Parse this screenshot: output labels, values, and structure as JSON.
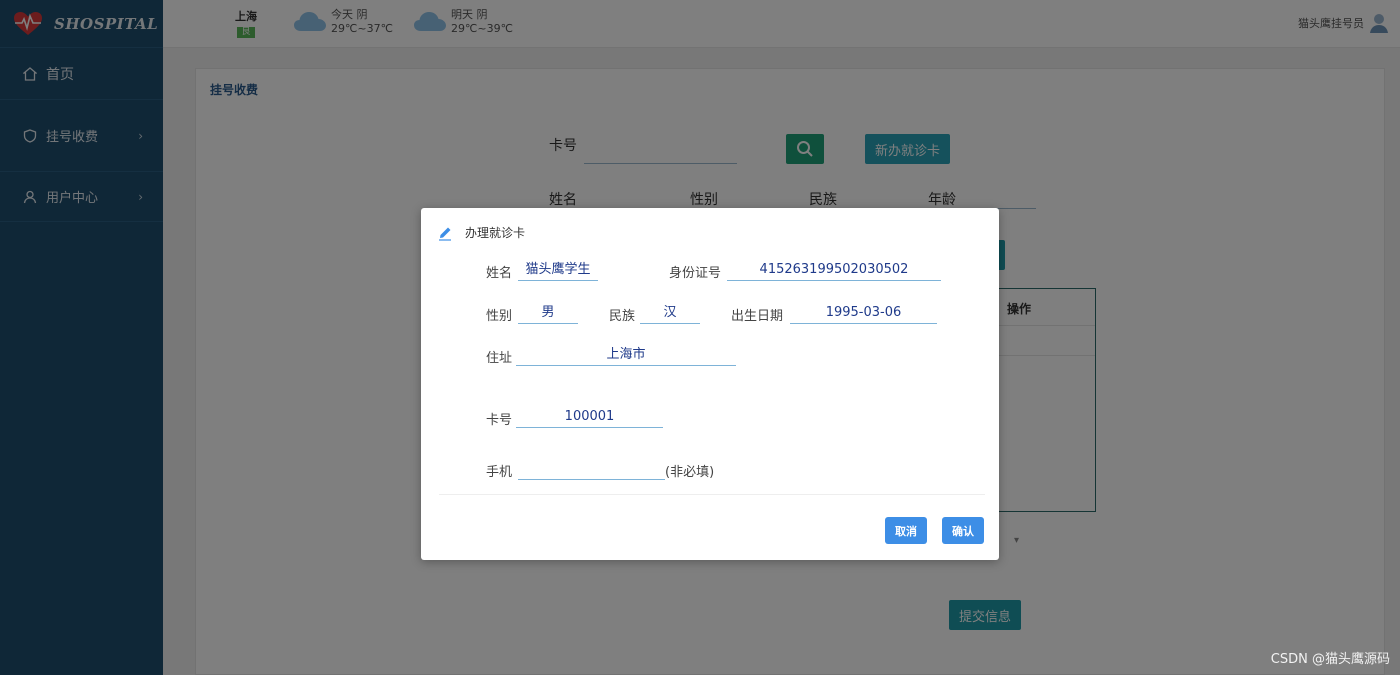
{
  "brand": {
    "name": "SHOSPITAL"
  },
  "sidebar": {
    "items": [
      {
        "label": "首页",
        "icon": "home-icon"
      },
      {
        "label": "挂号收费",
        "icon": "shield-icon",
        "has_children": true
      },
      {
        "label": "用户中心",
        "icon": "user-icon",
        "has_children": true
      }
    ]
  },
  "header": {
    "city": "上海",
    "aqi": "良",
    "today": {
      "label": "今天",
      "condition": "阴",
      "temp": "29℃~37℃"
    },
    "tomorrow": {
      "label": "明天",
      "condition": "阴",
      "temp": "29℃~39℃"
    },
    "user": "猫头鹰挂号员"
  },
  "page": {
    "title": "挂号收费",
    "card_label": "卡号",
    "new_card_button": "新办就诊卡",
    "name_label": "姓名",
    "gender_label": "性别",
    "ethnicity_label": "民族",
    "age_label": "年龄",
    "table_col_action": "操作",
    "submit_button": "提交信息"
  },
  "modal": {
    "title": "办理就诊卡",
    "name_label": "姓名",
    "name_value": "猫头鹰学生",
    "id_label": "身份证号",
    "id_value": "415263199502030502",
    "gender_label": "性别",
    "gender_value": "男",
    "ethnicity_label": "民族",
    "ethnicity_value": "汉",
    "birth_label": "出生日期",
    "birth_value": "1995-03-06",
    "address_label": "住址",
    "address_value": "上海市",
    "card_label": "卡号",
    "card_value": "100001",
    "phone_label": "手机",
    "phone_value": "",
    "phone_note": "(非必填)",
    "cancel_button": "取消",
    "confirm_button": "确认"
  },
  "watermark": "CSDN @猫头鹰源码",
  "colors": {
    "sidebar": "#1f4e6e",
    "primary_button": "#3d8ee6",
    "search_button": "#1ea078"
  }
}
